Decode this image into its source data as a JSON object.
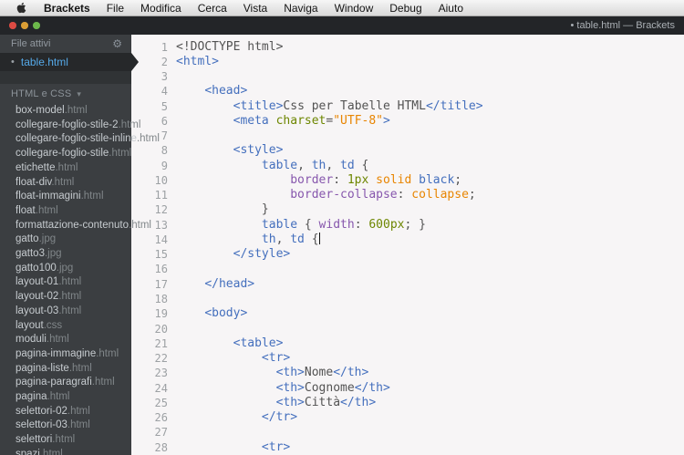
{
  "menubar": {
    "apple_icon": "apple-logo",
    "items": [
      "Brackets",
      "File",
      "Modifica",
      "Cerca",
      "Vista",
      "Naviga",
      "Window",
      "Debug",
      "Aiuto"
    ]
  },
  "titlebar": {
    "title": "• table.html — Brackets",
    "traffic_lights": [
      "close",
      "minimize",
      "zoom"
    ]
  },
  "sidebar": {
    "working_files_header": "File attivi",
    "gear_icon": "⚙",
    "active_file": {
      "dirty_dot": "•",
      "name": "table.html"
    },
    "section_header": "HTML e CSS",
    "section_caret": "▾",
    "files": [
      {
        "base": "box-model",
        "ext": ".html"
      },
      {
        "base": "collegare-foglio-stile-2",
        "ext": ".html"
      },
      {
        "base": "collegare-foglio-stile-inline",
        "ext": ".html"
      },
      {
        "base": "collegare-foglio-stile",
        "ext": ".html"
      },
      {
        "base": "etichette",
        "ext": ".html"
      },
      {
        "base": "float-div",
        "ext": ".html"
      },
      {
        "base": "float-immagini",
        "ext": ".html"
      },
      {
        "base": "float",
        "ext": ".html"
      },
      {
        "base": "formattazione-contenuto",
        "ext": ".html"
      },
      {
        "base": "gatto",
        "ext": ".jpg"
      },
      {
        "base": "gatto3",
        "ext": ".jpg"
      },
      {
        "base": "gatto100",
        "ext": ".jpg"
      },
      {
        "base": "layout-01",
        "ext": ".html"
      },
      {
        "base": "layout-02",
        "ext": ".html"
      },
      {
        "base": "layout-03",
        "ext": ".html"
      },
      {
        "base": "layout",
        "ext": ".css"
      },
      {
        "base": "moduli",
        "ext": ".html"
      },
      {
        "base": "pagina-immagine",
        "ext": ".html"
      },
      {
        "base": "pagina-liste",
        "ext": ".html"
      },
      {
        "base": "pagina-paragrafi",
        "ext": ".html"
      },
      {
        "base": "pagina",
        "ext": ".html"
      },
      {
        "base": "selettori-02",
        "ext": ".html"
      },
      {
        "base": "selettori-03",
        "ext": ".html"
      },
      {
        "base": "selettori",
        "ext": ".html"
      },
      {
        "base": "spazi",
        "ext": ".html"
      }
    ]
  },
  "colors": {
    "accent_blue_active_file": "#55a9e8",
    "sidebar_background": "#3b3e41",
    "titlebar_background": "#232528",
    "editor_background": "#f7f5f6"
  },
  "editor": {
    "cursor": {
      "line": 14
    },
    "token_colors": {
      "d": "#535353",
      "t": "#446fbd",
      "a": "#6d8600",
      "s": "#e88501",
      "p": "#8757ad",
      "n": "#6d8600",
      "o": "#e88501"
    },
    "lines": [
      {
        "n": 1,
        "t": [
          [
            "d",
            "<!DOCTYPE html>"
          ]
        ]
      },
      {
        "n": 2,
        "t": [
          [
            "t",
            "<html>"
          ]
        ]
      },
      {
        "n": 3,
        "t": []
      },
      {
        "n": 4,
        "t": [
          [
            "d",
            "    "
          ],
          [
            "t",
            "<head>"
          ]
        ]
      },
      {
        "n": 5,
        "t": [
          [
            "d",
            "        "
          ],
          [
            "t",
            "<title>"
          ],
          [
            "d",
            "Css per Tabelle HTML"
          ],
          [
            "t",
            "</title>"
          ]
        ]
      },
      {
        "n": 6,
        "t": [
          [
            "d",
            "        "
          ],
          [
            "t",
            "<meta "
          ],
          [
            "a",
            "charset"
          ],
          [
            "d",
            "="
          ],
          [
            "s",
            "\"UTF-8\""
          ],
          [
            "t",
            ">"
          ]
        ]
      },
      {
        "n": 7,
        "t": []
      },
      {
        "n": 8,
        "t": [
          [
            "d",
            "        "
          ],
          [
            "t",
            "<style>"
          ]
        ]
      },
      {
        "n": 9,
        "t": [
          [
            "d",
            "            "
          ],
          [
            "t",
            "table"
          ],
          [
            "d",
            ", "
          ],
          [
            "t",
            "th"
          ],
          [
            "d",
            ", "
          ],
          [
            "t",
            "td"
          ],
          [
            "d",
            " {"
          ]
        ]
      },
      {
        "n": 10,
        "t": [
          [
            "d",
            "                "
          ],
          [
            "p",
            "border"
          ],
          [
            "d",
            ": "
          ],
          [
            "n",
            "1px"
          ],
          [
            "d",
            " "
          ],
          [
            "o",
            "solid"
          ],
          [
            "d",
            " "
          ],
          [
            "t",
            "black"
          ],
          [
            "d",
            ";"
          ]
        ]
      },
      {
        "n": 11,
        "t": [
          [
            "d",
            "                "
          ],
          [
            "p",
            "border-collapse"
          ],
          [
            "d",
            ": "
          ],
          [
            "o",
            "collapse"
          ],
          [
            "d",
            ";"
          ]
        ]
      },
      {
        "n": 12,
        "t": [
          [
            "d",
            "            }"
          ]
        ]
      },
      {
        "n": 13,
        "t": [
          [
            "d",
            "            "
          ],
          [
            "t",
            "table"
          ],
          [
            "d",
            " { "
          ],
          [
            "p",
            "width"
          ],
          [
            "d",
            ": "
          ],
          [
            "n",
            "600px"
          ],
          [
            "d",
            "; }"
          ]
        ]
      },
      {
        "n": 14,
        "t": [
          [
            "d",
            "            "
          ],
          [
            "t",
            "th"
          ],
          [
            "d",
            ", "
          ],
          [
            "t",
            "td"
          ],
          [
            "d",
            " {"
          ]
        ]
      },
      {
        "n": 15,
        "t": [
          [
            "d",
            "        "
          ],
          [
            "t",
            "</style>"
          ]
        ]
      },
      {
        "n": 16,
        "t": []
      },
      {
        "n": 17,
        "t": [
          [
            "d",
            "    "
          ],
          [
            "t",
            "</head>"
          ]
        ]
      },
      {
        "n": 18,
        "t": []
      },
      {
        "n": 19,
        "t": [
          [
            "d",
            "    "
          ],
          [
            "t",
            "<body>"
          ]
        ]
      },
      {
        "n": 20,
        "t": []
      },
      {
        "n": 21,
        "t": [
          [
            "d",
            "        "
          ],
          [
            "t",
            "<table>"
          ]
        ]
      },
      {
        "n": 22,
        "t": [
          [
            "d",
            "            "
          ],
          [
            "t",
            "<tr>"
          ]
        ]
      },
      {
        "n": 23,
        "t": [
          [
            "d",
            "              "
          ],
          [
            "t",
            "<th>"
          ],
          [
            "d",
            "Nome"
          ],
          [
            "t",
            "</th>"
          ]
        ]
      },
      {
        "n": 24,
        "t": [
          [
            "d",
            "              "
          ],
          [
            "t",
            "<th>"
          ],
          [
            "d",
            "Cognome"
          ],
          [
            "t",
            "</th>"
          ]
        ]
      },
      {
        "n": 25,
        "t": [
          [
            "d",
            "              "
          ],
          [
            "t",
            "<th>"
          ],
          [
            "d",
            "Città"
          ],
          [
            "t",
            "</th>"
          ]
        ]
      },
      {
        "n": 26,
        "t": [
          [
            "d",
            "            "
          ],
          [
            "t",
            "</tr>"
          ]
        ]
      },
      {
        "n": 27,
        "t": []
      },
      {
        "n": 28,
        "t": [
          [
            "d",
            "            "
          ],
          [
            "t",
            "<tr>"
          ]
        ]
      }
    ]
  }
}
